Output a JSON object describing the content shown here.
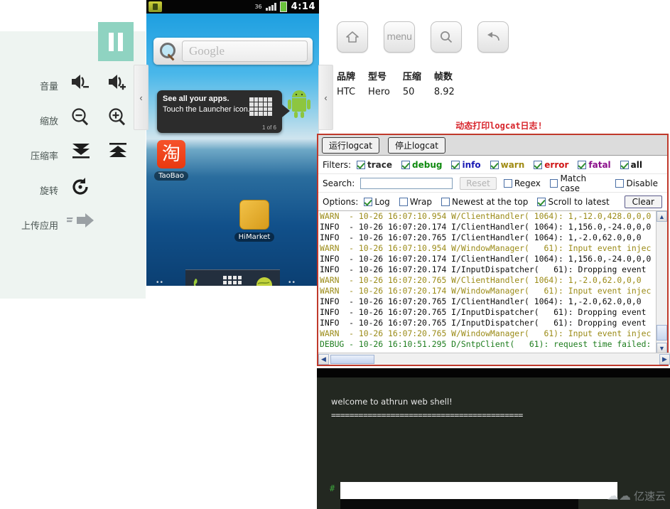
{
  "left_panel": {
    "pause_button": "pause-button",
    "controls": [
      {
        "label": "音量",
        "icons": [
          "volume-down-icon",
          "volume-up-icon"
        ]
      },
      {
        "label": "缩放",
        "icons": [
          "zoom-out-icon",
          "zoom-in-icon"
        ]
      },
      {
        "label": "压缩率",
        "icons": [
          "compress-down-icon",
          "compress-up-icon"
        ]
      },
      {
        "label": "旋转",
        "icons": [
          "rotate-icon"
        ]
      },
      {
        "label": "上传应用",
        "icons": [
          "upload-arrow-icon"
        ]
      }
    ],
    "collapse_left": "‹",
    "collapse_right": "‹"
  },
  "phone": {
    "status_bar": {
      "signal_text": "36",
      "time": "4:14"
    },
    "search_widget": {
      "placeholder": "Google"
    },
    "tip": {
      "title": "See all your apps.",
      "subtitle": "Touch the Launcher icon.",
      "counter": "1 of 6"
    },
    "apps": [
      {
        "name": "TaoBao",
        "glyph": "淘"
      },
      {
        "name": "HiMarket",
        "glyph": ""
      }
    ],
    "dock": [
      "phone-icon",
      "app-drawer-icon",
      "browser-icon"
    ],
    "page_dots_left": "••",
    "page_dots_right": "••"
  },
  "nav": {
    "buttons": [
      {
        "name": "home-button",
        "label": ""
      },
      {
        "name": "menu-button",
        "label": "menu"
      },
      {
        "name": "search-button",
        "label": ""
      },
      {
        "name": "back-button",
        "label": ""
      }
    ]
  },
  "device_info": {
    "headers": [
      "品牌",
      "型号",
      "压缩",
      "帧数"
    ],
    "values": [
      "HTC",
      "Hero",
      "50",
      "8.92"
    ]
  },
  "panel_title": "动态打印logcat日志!",
  "logcat": {
    "run_button": "运行logcat",
    "stop_button": "停止logcat",
    "filters_label": "Filters:",
    "filters": [
      {
        "label": "trace",
        "checked": true,
        "color": "#2b2b2b"
      },
      {
        "label": "debug",
        "checked": true,
        "color": "#0f8a0f"
      },
      {
        "label": "info",
        "checked": true,
        "color": "#1a1ab4"
      },
      {
        "label": "warn",
        "checked": true,
        "color": "#a08a12"
      },
      {
        "label": "error",
        "checked": true,
        "color": "#d01515"
      },
      {
        "label": "fatal",
        "checked": true,
        "color": "#8b0f8b"
      },
      {
        "label": "all",
        "checked": true,
        "color": "#101010"
      }
    ],
    "search_label": "Search:",
    "search_value": "",
    "reset_button": "Reset",
    "search_options": [
      {
        "label": "Regex",
        "checked": false
      },
      {
        "label": "Match case",
        "checked": false
      },
      {
        "label": "Disable",
        "checked": false
      }
    ],
    "options_label": "Options:",
    "options": [
      {
        "label": "Log",
        "checked": true
      },
      {
        "label": "Wrap",
        "checked": false
      },
      {
        "label": "Newest at the top",
        "checked": false
      },
      {
        "label": "Scroll to latest",
        "checked": true
      }
    ],
    "clear_button": "Clear",
    "lines": [
      {
        "level": "WARN",
        "text": "WARN  - 10-26 16:07:10.954 W/ClientHandler( 1064): 1,-12.0,428.0,0,0"
      },
      {
        "level": "INFO",
        "text": "INFO  - 10-26 16:07:20.174 I/ClientHandler( 1064): 1,156.0,-24.0,0,0"
      },
      {
        "level": "INFO",
        "text": "INFO  - 10-26 16:07:20.765 I/ClientHandler( 1064): 1,-2.0,62.0,0,0"
      },
      {
        "level": "WARN",
        "text": "WARN  - 10-26 16:07:10.954 W/WindowManager(   61): Input event injec"
      },
      {
        "level": "INFO",
        "text": "INFO  - 10-26 16:07:20.174 I/ClientHandler( 1064): 1,156.0,-24.0,0,0"
      },
      {
        "level": "INFO",
        "text": "INFO  - 10-26 16:07:20.174 I/InputDispatcher(   61): Dropping event"
      },
      {
        "level": "WARN",
        "text": "WARN  - 10-26 16:07:20.765 W/ClientHandler( 1064): 1,-2.0,62.0,0,0"
      },
      {
        "level": "WARN",
        "text": "WARN  - 10-26 16:07:20.174 W/WindowManager(   61): Input event injec"
      },
      {
        "level": "INFO",
        "text": "INFO  - 10-26 16:07:20.765 I/ClientHandler( 1064): 1,-2.0,62.0,0,0"
      },
      {
        "level": "INFO",
        "text": "INFO  - 10-26 16:07:20.765 I/InputDispatcher(   61): Dropping event"
      },
      {
        "level": "INFO",
        "text": "INFO  - 10-26 16:07:20.765 I/InputDispatcher(   61): Dropping event"
      },
      {
        "level": "WARN",
        "text": "WARN  - 10-26 16:07:20.765 W/WindowManager(   61): Input event injec"
      },
      {
        "level": "DEBUG",
        "text": "DEBUG - 10-26 16:10:51.295 D/SntpClient(   61): request time failed:"
      }
    ]
  },
  "shell": {
    "welcome": "welcome to athrun web shell!",
    "rule": "==========================================",
    "prompt": "#",
    "input_value": ""
  },
  "watermark": "亿速云"
}
